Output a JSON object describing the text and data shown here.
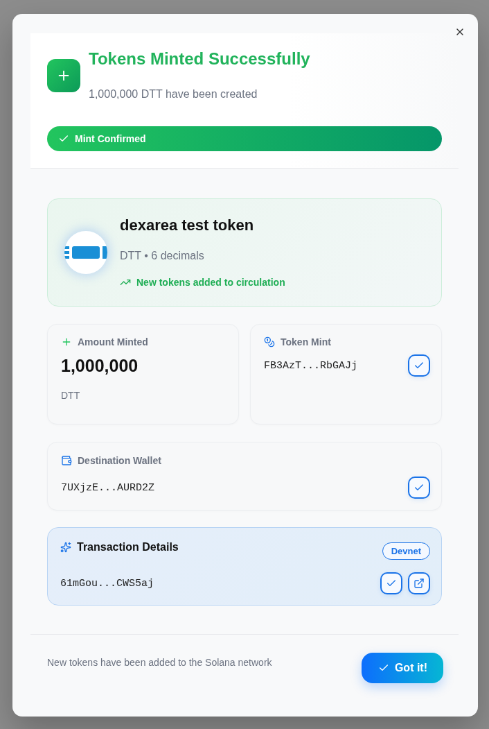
{
  "header": {
    "title": "Tokens Minted Successfully",
    "subtitle": "1,000,000 DTT have been created",
    "status": "Mint Confirmed"
  },
  "token": {
    "name": "dexarea test token",
    "meta": "DTT • 6 decimals",
    "note": "New tokens added to circulation"
  },
  "details": [
    {
      "kind": "amount",
      "label": "Amount Minted",
      "value": "1,000,000",
      "unit": "DTT"
    },
    {
      "kind": "address",
      "label": "Token Mint",
      "value": "FB3AzT...RbGAJj"
    }
  ],
  "wallet": {
    "label": "Destination Wallet",
    "value": "7UXjzE...AURD2Z"
  },
  "transaction": {
    "label": "Transaction Details",
    "network": "Devnet",
    "value": "61mGou...CWS5aj"
  },
  "footer": {
    "message": "New tokens have been added to the Solana network",
    "button": "Got it!"
  }
}
